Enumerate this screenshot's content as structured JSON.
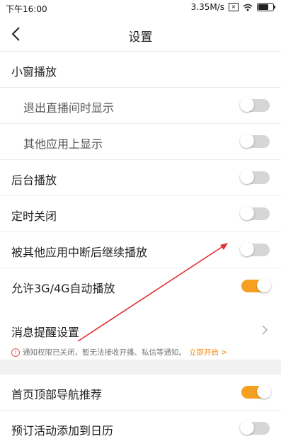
{
  "status_bar": {
    "time": "下午16:00",
    "network_speed": "3.35M/s",
    "x_badge": "×"
  },
  "header": {
    "title": "设置"
  },
  "group1": {
    "items": [
      {
        "label": "小窗播放"
      },
      {
        "label": "退出直播间时显示",
        "toggle": false
      },
      {
        "label": "其他应用上显示",
        "toggle": false
      },
      {
        "label": "后台播放",
        "toggle": false
      },
      {
        "label": "定时关闭",
        "toggle": false
      },
      {
        "label": "被其他应用中断后继续播放",
        "toggle": false
      },
      {
        "label": "允许3G/4G自动播放",
        "toggle": true
      }
    ]
  },
  "notify": {
    "title": "消息提醒设置",
    "warning": "通知权限已关闭，暂无法接收开播、私信等通知。",
    "action": "立即开启 >",
    "warning_icon": "!"
  },
  "group2": {
    "items": [
      {
        "label": "首页顶部导航推荐",
        "toggle": true
      },
      {
        "label": "预订活动添加到日历",
        "toggle": false
      }
    ]
  },
  "colors": {
    "accent": "#f5a020",
    "link": "#f58a12",
    "arrow": "#e03030"
  }
}
